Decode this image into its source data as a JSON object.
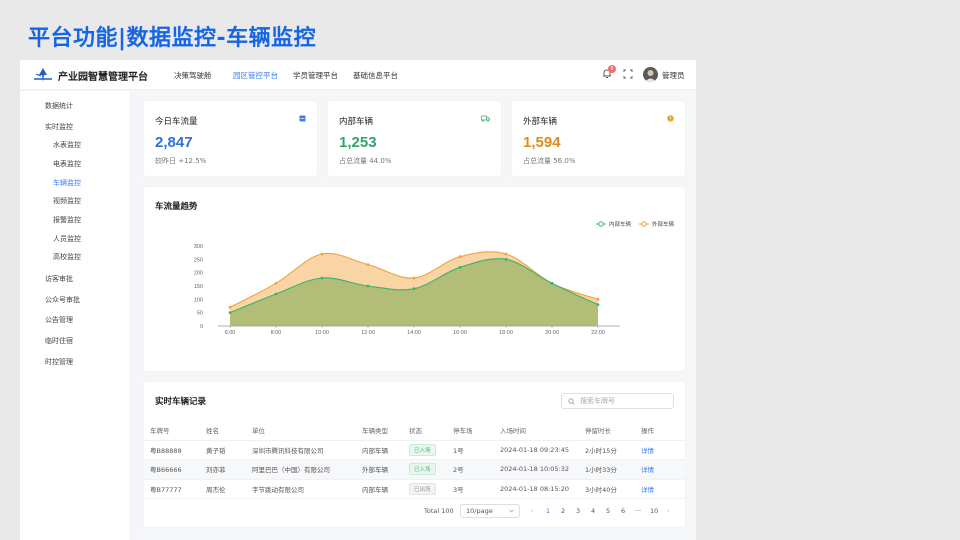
{
  "slide_title": "平台功能|数据监控-车辆监控",
  "app": {
    "brand": "产业园智慧管理平台",
    "nav": [
      "决策驾驶舱",
      "园区管控平台",
      "学员管理平台",
      "基础信息平台"
    ],
    "nav_active": "园区管控平台",
    "notification_count": "5",
    "username": "管理员"
  },
  "sidebar": {
    "items": [
      {
        "label": "数据统计",
        "level": 1
      },
      {
        "label": "实时监控",
        "level": 1
      },
      {
        "label": "水表监控",
        "level": 2
      },
      {
        "label": "电表监控",
        "level": 2
      },
      {
        "label": "车辆监控",
        "level": 2,
        "active": true
      },
      {
        "label": "视频监控",
        "level": 2
      },
      {
        "label": "报警监控",
        "level": 2
      },
      {
        "label": "人员监控",
        "level": 2
      },
      {
        "label": "高校监控",
        "level": 2
      },
      {
        "label": "访客审批",
        "level": 1
      },
      {
        "label": "公众号审批",
        "level": 1
      },
      {
        "label": "公告管理",
        "level": 1
      },
      {
        "label": "临时住宿",
        "level": 1
      },
      {
        "label": "时控管理",
        "level": 1
      }
    ]
  },
  "stats": [
    {
      "title": "今日车流量",
      "value": "2,847",
      "sub": "较昨日 +12.5%",
      "color": "#2f6fe0",
      "icon": "calendar-icon"
    },
    {
      "title": "内部车辆",
      "value": "1,253",
      "sub": "占总流量 44.0%",
      "color": "#2ea66b",
      "icon": "truck-icon"
    },
    {
      "title": "外部车辆",
      "value": "1,594",
      "sub": "占总流量 56.0%",
      "color": "#e08a1a",
      "icon": "info-icon"
    }
  ],
  "trend": {
    "title": "车流量趋势",
    "legend": [
      "内部车辆",
      "外部车辆"
    ]
  },
  "chart_data": {
    "type": "area",
    "x": [
      "6:00",
      "8:00",
      "10:00",
      "12:00",
      "14:00",
      "16:00",
      "18:00",
      "20:00",
      "22:00"
    ],
    "ylim": [
      0,
      300
    ],
    "yticks": [
      "300",
      "250",
      "200",
      "150",
      "100",
      "50",
      "0"
    ],
    "series": [
      {
        "name": "内部车辆",
        "values": [
          50,
          120,
          180,
          150,
          140,
          220,
          250,
          160,
          80
        ],
        "color": "#3bb36a"
      },
      {
        "name": "外部车辆",
        "values": [
          70,
          160,
          270,
          230,
          180,
          260,
          270,
          160,
          100
        ],
        "color": "#f2a23a"
      }
    ],
    "legend_position": "top-right",
    "grid": false
  },
  "records": {
    "title": "实时车辆记录",
    "search_placeholder": "搜索车牌号",
    "columns": [
      "车牌号",
      "姓名",
      "单位",
      "车辆类型",
      "状态",
      "停车场",
      "入场时间",
      "停留时长",
      "操作"
    ],
    "rows": [
      [
        "粤B88888",
        "黄子韬",
        "深圳市腾讯科技有限公司",
        "内部车辆",
        "已入场",
        "1号",
        "2024-01-18 09:23:45",
        "2小时15分",
        "详情"
      ],
      [
        "粤B66666",
        "刘亦菲",
        "阿里巴巴（中国）有限公司",
        "外部车辆",
        "已入场",
        "2号",
        "2024-01-18 10:05:32",
        "1小时33分",
        "详情"
      ],
      [
        "粤B77777",
        "周杰伦",
        "字节跳动有限公司",
        "内部车辆",
        "已出场",
        "3号",
        "2024-01-18 08:15:20",
        "3小时40分",
        "详情"
      ]
    ],
    "row_status_type": [
      "in",
      "in",
      "out"
    ],
    "total": "Total 100",
    "page_size": "10/page",
    "pages": [
      "1",
      "2",
      "3",
      "4",
      "5",
      "6",
      "···",
      "10"
    ],
    "prev": "‹",
    "next": "›"
  }
}
